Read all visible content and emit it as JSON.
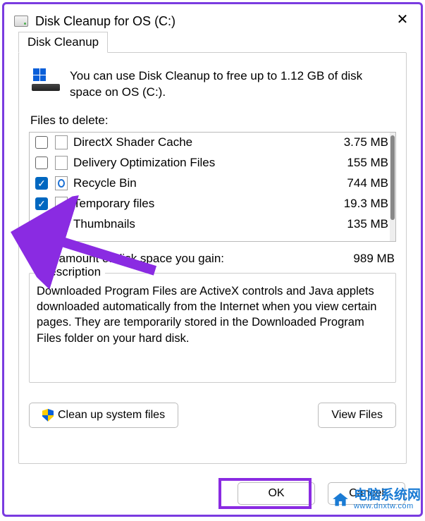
{
  "window": {
    "title": "Disk Cleanup for OS (C:)"
  },
  "tab": "Disk Cleanup",
  "intro": "You can use Disk Cleanup to free up to 1.12 GB of disk space on OS (C:).",
  "files_label": "Files to delete:",
  "files": [
    {
      "name": "DirectX Shader Cache",
      "size": "3.75 MB",
      "checked": false,
      "icon": "file"
    },
    {
      "name": "Delivery Optimization Files",
      "size": "155 MB",
      "checked": false,
      "icon": "file"
    },
    {
      "name": "Recycle Bin",
      "size": "744 MB",
      "checked": true,
      "icon": "bin"
    },
    {
      "name": "Temporary files",
      "size": "19.3 MB",
      "checked": true,
      "icon": "file"
    },
    {
      "name": "Thumbnails",
      "size": "135 MB",
      "checked": true,
      "icon": "file"
    }
  ],
  "total_label": "Total amount of disk space you gain:",
  "total_value": "989 MB",
  "description": {
    "legend": "Description",
    "text": "Downloaded Program Files are ActiveX controls and Java applets downloaded automatically from the Internet when you view certain pages. They are temporarily stored in the Downloaded Program Files folder on your hard disk."
  },
  "buttons": {
    "cleanup": "Clean up system files",
    "view": "View Files",
    "ok": "OK",
    "cancel": "Cancel"
  },
  "watermark": {
    "cn": "电脑系统网",
    "url": "www.dnxtw.com"
  }
}
